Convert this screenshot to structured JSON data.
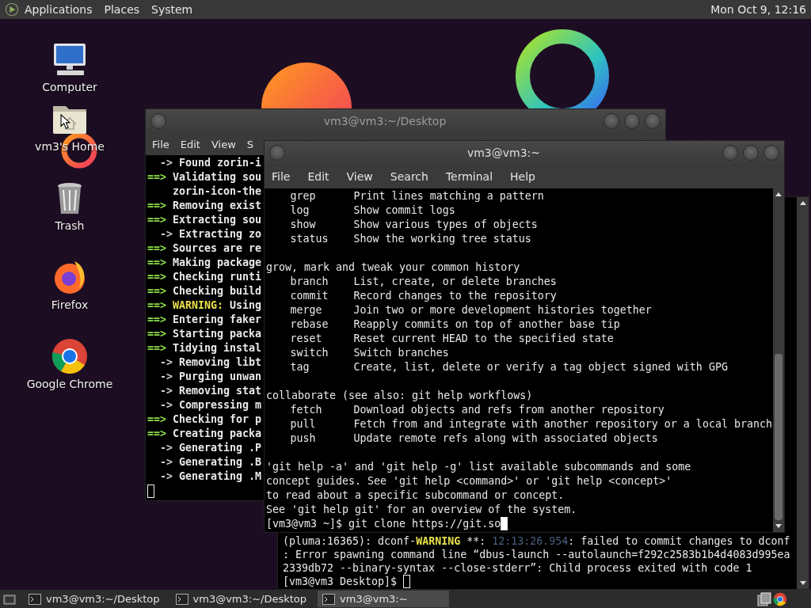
{
  "top_panel": {
    "menus": [
      "Applications",
      "Places",
      "System"
    ],
    "clock": "Mon Oct 9, 12:16"
  },
  "desktop_icons": [
    {
      "kind": "computer",
      "label": "Computer"
    },
    {
      "kind": "home",
      "label": "vm3's Home"
    },
    {
      "kind": "trash",
      "label": "Trash"
    },
    {
      "kind": "firefox",
      "label": "Firefox"
    },
    {
      "kind": "chrome",
      "label": "Google Chrome"
    }
  ],
  "build_terminal": {
    "title": "vm3@vm3:~/Desktop",
    "focused": false,
    "menus": [
      "File",
      "Edit",
      "View",
      "S"
    ],
    "lines": [
      {
        "kind": "arrow",
        "prefix": "->",
        "text": "Found zorin-i"
      },
      {
        "kind": "step",
        "prefix": "==>",
        "text": "Validating sou"
      },
      {
        "kind": "cont",
        "text": "zorin-icon-the"
      },
      {
        "kind": "step",
        "prefix": "==>",
        "text": "Removing exist"
      },
      {
        "kind": "step",
        "prefix": "==>",
        "text": "Extracting sou"
      },
      {
        "kind": "arrow",
        "prefix": "->",
        "text": "Extracting zo"
      },
      {
        "kind": "step",
        "prefix": "==>",
        "text": "Sources are re"
      },
      {
        "kind": "step",
        "prefix": "==>",
        "text": "Making package"
      },
      {
        "kind": "step",
        "prefix": "==>",
        "text": "Checking runti"
      },
      {
        "kind": "step",
        "prefix": "==>",
        "text": "Checking build"
      },
      {
        "kind": "warn",
        "prefix": "==>",
        "label": "WARNING:",
        "text": "Using"
      },
      {
        "kind": "step",
        "prefix": "==>",
        "text": "Entering faker"
      },
      {
        "kind": "step",
        "prefix": "==>",
        "text": "Starting packa"
      },
      {
        "kind": "step",
        "prefix": "==>",
        "text": "Tidying instal"
      },
      {
        "kind": "arrow",
        "prefix": "->",
        "text": "Removing libt"
      },
      {
        "kind": "arrow",
        "prefix": "->",
        "text": "Purging unwan"
      },
      {
        "kind": "arrow",
        "prefix": "->",
        "text": "Removing stat"
      },
      {
        "kind": "arrow",
        "prefix": "->",
        "text": "Compressing m"
      },
      {
        "kind": "step",
        "prefix": "==>",
        "text": "Checking for p"
      },
      {
        "kind": "step",
        "prefix": "==>",
        "text": "Creating packa"
      },
      {
        "kind": "arrow",
        "prefix": "->",
        "text": "Generating .P"
      },
      {
        "kind": "arrow",
        "prefix": "->",
        "text": "Generating .B"
      },
      {
        "kind": "arrow",
        "prefix": "->",
        "text": "Generating .M"
      }
    ]
  },
  "git_terminal": {
    "title": "vm3@vm3:~",
    "focused": true,
    "menus": [
      "File",
      "Edit",
      "View",
      "Search",
      "Terminal",
      "Help"
    ],
    "sections": [
      {
        "commands": [
          {
            "name": "grep",
            "description": "Print lines matching a pattern"
          },
          {
            "name": "log",
            "description": "Show commit logs"
          },
          {
            "name": "show",
            "description": "Show various types of objects"
          },
          {
            "name": "status",
            "description": "Show the working tree status"
          }
        ]
      },
      {
        "heading": "grow, mark and tweak your common history",
        "commands": [
          {
            "name": "branch",
            "description": "List, create, or delete branches"
          },
          {
            "name": "commit",
            "description": "Record changes to the repository"
          },
          {
            "name": "merge",
            "description": "Join two or more development histories together"
          },
          {
            "name": "rebase",
            "description": "Reapply commits on top of another base tip"
          },
          {
            "name": "reset",
            "description": "Reset current HEAD to the specified state"
          },
          {
            "name": "switch",
            "description": "Switch branches"
          },
          {
            "name": "tag",
            "description": "Create, list, delete or verify a tag object signed with GPG"
          }
        ]
      },
      {
        "heading": "collaborate (see also: git help workflows)",
        "commands": [
          {
            "name": "fetch",
            "description": "Download objects and refs from another repository"
          },
          {
            "name": "pull",
            "description": "Fetch from and integrate with another repository or a local branch"
          },
          {
            "name": "push",
            "description": "Update remote refs along with associated objects"
          }
        ]
      }
    ],
    "footer": [
      "'git help -a' and 'git help -g' list available subcommands and some",
      "concept guides. See 'git help <command>' or 'git help <concept>'",
      "to read about a specific subcommand or concept.",
      "See 'git help git' for an overview of the system."
    ],
    "prompt": "[vm3@vm3 ~]$ git clone https://git.so"
  },
  "dconf_terminal": {
    "focused": false,
    "lines": [
      [
        {
          "kind": "plain",
          "text": "(pluma:16365): dconf-"
        },
        {
          "kind": "warn",
          "text": "WARNING"
        },
        {
          "kind": "plain",
          "text": " **: "
        },
        {
          "kind": "time",
          "text": "12:13:26.954"
        },
        {
          "kind": "plain",
          "text": ": failed to commit changes to dconf"
        }
      ],
      [
        {
          "kind": "plain",
          "text": ": Error spawning command line “dbus-launch --autolaunch=f292c2583b1b4d4083d995ea"
        }
      ],
      [
        {
          "kind": "plain",
          "text": "2339db72 --binary-syntax --close-stderr”: Child process exited with code 1"
        }
      ]
    ],
    "prompt": "[vm3@vm3 Desktop]$ "
  },
  "taskbar": {
    "tasks": [
      {
        "label": "vm3@vm3:~/Desktop",
        "selected": false
      },
      {
        "label": "vm3@vm3:~/Desktop",
        "selected": false
      },
      {
        "label": "vm3@vm3:~",
        "selected": true
      }
    ]
  }
}
